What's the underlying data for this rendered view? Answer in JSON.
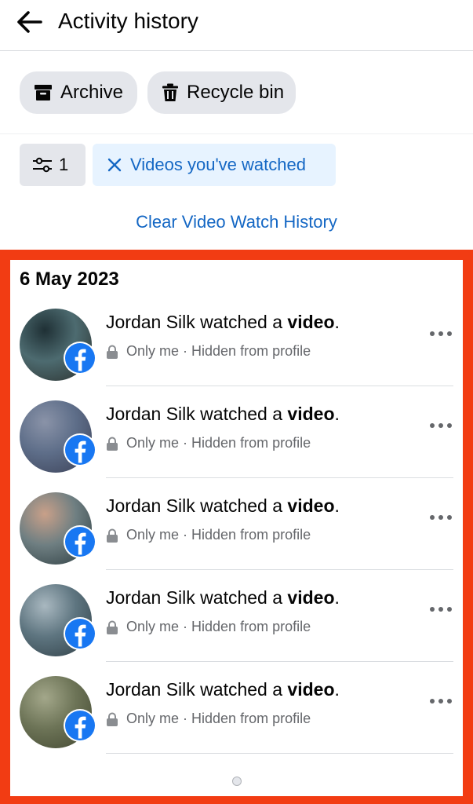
{
  "header": {
    "title": "Activity history"
  },
  "chips": {
    "archive_label": "Archive",
    "recycle_label": "Recycle bin"
  },
  "filters": {
    "count": "1",
    "active_label": "Videos you've watched"
  },
  "clear_link": "Clear Video Watch History",
  "section": {
    "date": "6 May 2023",
    "items": [
      {
        "actor": "Jordan Silk",
        "action": "watched a",
        "object": "video",
        "end": ".",
        "privacy": "Only me",
        "visibility": "Hidden from profile",
        "thumb_colors": [
          "#1f3035",
          "#4d6b70",
          "#2a2e2b"
        ]
      },
      {
        "actor": "Jordan Silk",
        "action": "watched a",
        "object": "video",
        "end": ".",
        "privacy": "Only me",
        "visibility": "Hidden from profile",
        "thumb_colors": [
          "#8a93a8",
          "#5e6e89",
          "#3a3f55"
        ]
      },
      {
        "actor": "Jordan Silk",
        "action": "watched a",
        "object": "video",
        "end": ".",
        "privacy": "Only me",
        "visibility": "Hidden from profile",
        "thumb_colors": [
          "#c9a089",
          "#6f7f82",
          "#2a3a3e"
        ]
      },
      {
        "actor": "Jordan Silk",
        "action": "watched a",
        "object": "video",
        "end": ".",
        "privacy": "Only me",
        "visibility": "Hidden from profile",
        "thumb_colors": [
          "#a9b8c0",
          "#5e7580",
          "#2e3d44"
        ]
      },
      {
        "actor": "Jordan Silk",
        "action": "watched a",
        "object": "video",
        "end": ".",
        "privacy": "Only me",
        "visibility": "Hidden from profile",
        "thumb_colors": [
          "#a3a78a",
          "#6d7457",
          "#40452f"
        ]
      }
    ]
  },
  "colors": {
    "accent": "#1467c4",
    "highlight_border": "#f23c13",
    "facebook_blue": "#1877f2",
    "chip_bg": "#e4e6eb",
    "active_filter_bg": "#e7f3ff"
  },
  "icons": {
    "back": "arrow-left-icon",
    "archive": "archive-box-icon",
    "recycle": "trash-can-icon",
    "filter": "sliders-icon",
    "remove_filter": "close-icon",
    "privacy": "lock-icon",
    "more": "ellipsis-icon",
    "badge": "facebook-logo-icon"
  }
}
